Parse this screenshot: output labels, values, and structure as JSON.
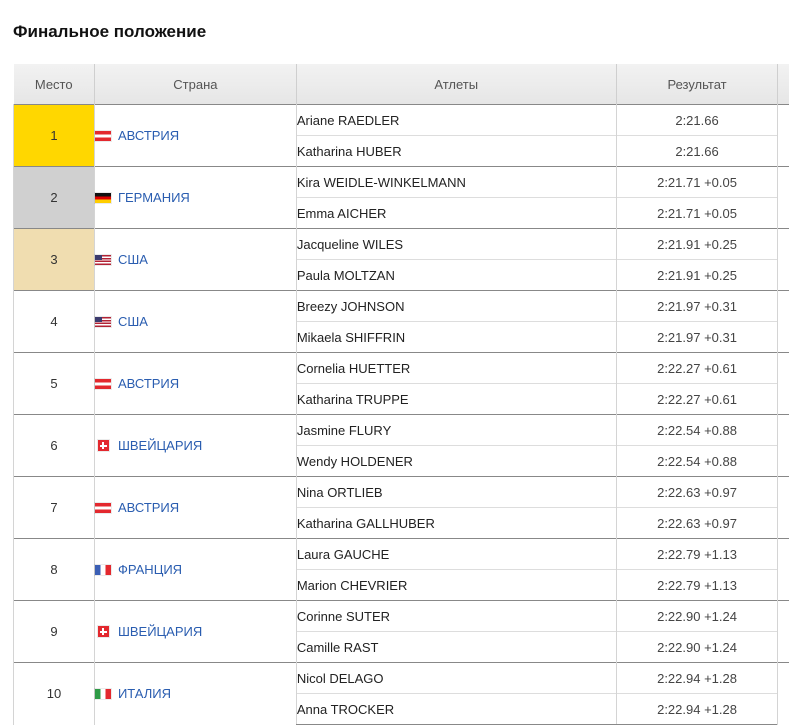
{
  "page": {
    "title": "Финальное положение"
  },
  "table": {
    "headers": {
      "place": "Место",
      "country": "Страна",
      "athletes": "Атлеты",
      "result": "Результат"
    },
    "rows": [
      {
        "place": "1",
        "medal": "gold",
        "country": "АВСТРИЯ",
        "flag_icon": "austria-flag-icon",
        "athletes": [
          {
            "name": "Ariane RAEDLER",
            "result": "2:21.66"
          },
          {
            "name": "Katharina HUBER",
            "result": "2:21.66"
          }
        ]
      },
      {
        "place": "2",
        "medal": "silver",
        "country": "ГЕРМАНИЯ",
        "flag_icon": "germany-flag-icon",
        "athletes": [
          {
            "name": "Kira WEIDLE-WINKELMANN",
            "result": "2:21.71 +0.05"
          },
          {
            "name": "Emma AICHER",
            "result": "2:21.71 +0.05"
          }
        ]
      },
      {
        "place": "3",
        "medal": "bronze",
        "country": "США",
        "flag_icon": "usa-flag-icon",
        "athletes": [
          {
            "name": "Jacqueline WILES",
            "result": "2:21.91 +0.25"
          },
          {
            "name": "Paula MOLTZAN",
            "result": "2:21.91 +0.25"
          }
        ]
      },
      {
        "place": "4",
        "medal": "",
        "country": "США",
        "flag_icon": "usa-flag-icon",
        "athletes": [
          {
            "name": "Breezy JOHNSON",
            "result": "2:21.97 +0.31"
          },
          {
            "name": "Mikaela SHIFFRIN",
            "result": "2:21.97 +0.31"
          }
        ]
      },
      {
        "place": "5",
        "medal": "",
        "country": "АВСТРИЯ",
        "flag_icon": "austria-flag-icon",
        "athletes": [
          {
            "name": "Cornelia HUETTER",
            "result": "2:22.27 +0.61"
          },
          {
            "name": "Katharina TRUPPE",
            "result": "2:22.27 +0.61"
          }
        ]
      },
      {
        "place": "6",
        "medal": "",
        "country": "ШВЕЙЦАРИЯ",
        "flag_icon": "switzerland-flag-icon",
        "athletes": [
          {
            "name": "Jasmine FLURY",
            "result": "2:22.54 +0.88"
          },
          {
            "name": "Wendy HOLDENER",
            "result": "2:22.54 +0.88"
          }
        ]
      },
      {
        "place": "7",
        "medal": "",
        "country": "АВСТРИЯ",
        "flag_icon": "austria-flag-icon",
        "athletes": [
          {
            "name": "Nina ORTLIEB",
            "result": "2:22.63 +0.97"
          },
          {
            "name": "Katharina GALLHUBER",
            "result": "2:22.63 +0.97"
          }
        ]
      },
      {
        "place": "8",
        "medal": "",
        "country": "ФРАНЦИЯ",
        "flag_icon": "france-flag-icon",
        "athletes": [
          {
            "name": "Laura GAUCHE",
            "result": "2:22.79 +1.13"
          },
          {
            "name": "Marion CHEVRIER",
            "result": "2:22.79 +1.13"
          }
        ]
      },
      {
        "place": "9",
        "medal": "",
        "country": "ШВЕЙЦАРИЯ",
        "flag_icon": "switzerland-flag-icon",
        "athletes": [
          {
            "name": "Corinne SUTER",
            "result": "2:22.90 +1.24"
          },
          {
            "name": "Camille RAST",
            "result": "2:22.90 +1.24"
          }
        ]
      },
      {
        "place": "10",
        "medal": "",
        "country": "ИТАЛИЯ",
        "flag_icon": "italy-flag-icon",
        "athletes": [
          {
            "name": "Nicol DELAGO",
            "result": "2:22.94 +1.28"
          },
          {
            "name": "Anna TROCKER",
            "result": "2:22.94 +1.28"
          }
        ]
      }
    ]
  }
}
